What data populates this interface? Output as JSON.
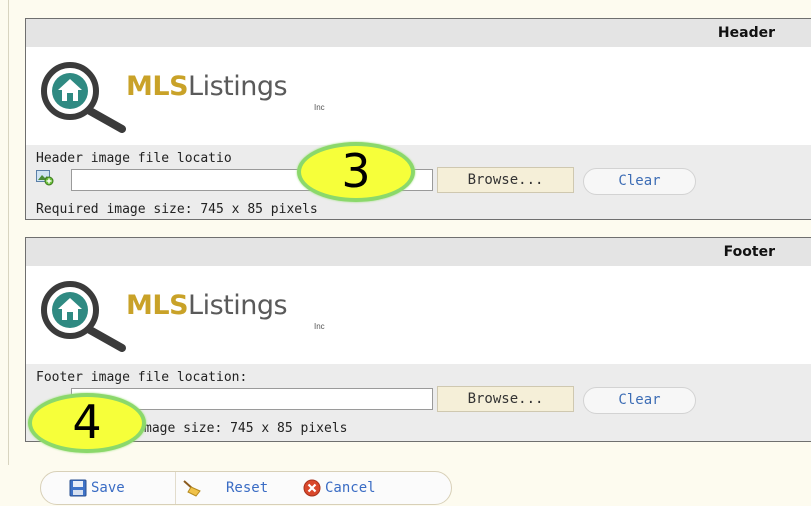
{
  "header_panel": {
    "title": "Header",
    "logo": {
      "brand_primary": "MLS",
      "brand_secondary": "Listings",
      "brand_suffix": "Inc"
    },
    "file_label": "Header image file locatio",
    "file_value": "",
    "browse_label": "Browse...",
    "clear_label": "Clear",
    "size_note": "Required image size: 745 x 85 pixels"
  },
  "footer_panel": {
    "title": "Footer",
    "logo": {
      "brand_primary": "MLS",
      "brand_secondary": "Listings",
      "brand_suffix": "Inc"
    },
    "file_label": "Footer image file location:",
    "file_value": "",
    "browse_label": "Browse...",
    "clear_label": "Clear",
    "size_note": "mage size: 745 x 85 pixels"
  },
  "callouts": [
    {
      "number": "3"
    },
    {
      "number": "4"
    }
  ],
  "actions": {
    "save_label": "Save",
    "reset_label": "Reset",
    "cancel_label": "Cancel"
  },
  "icons": {
    "file": "image-file-icon",
    "save": "floppy-disk-icon",
    "reset": "broom-icon",
    "cancel": "cancel-x-icon"
  },
  "colors": {
    "brand_gold": "#c9a228",
    "brand_gray": "#5a5a5a",
    "link_blue": "#3a6cc4",
    "callout_fill": "#f6ff3a",
    "callout_ring": "#8bd86b",
    "panel_header_bg": "#e4e4e4",
    "controls_bg": "#ececec"
  }
}
